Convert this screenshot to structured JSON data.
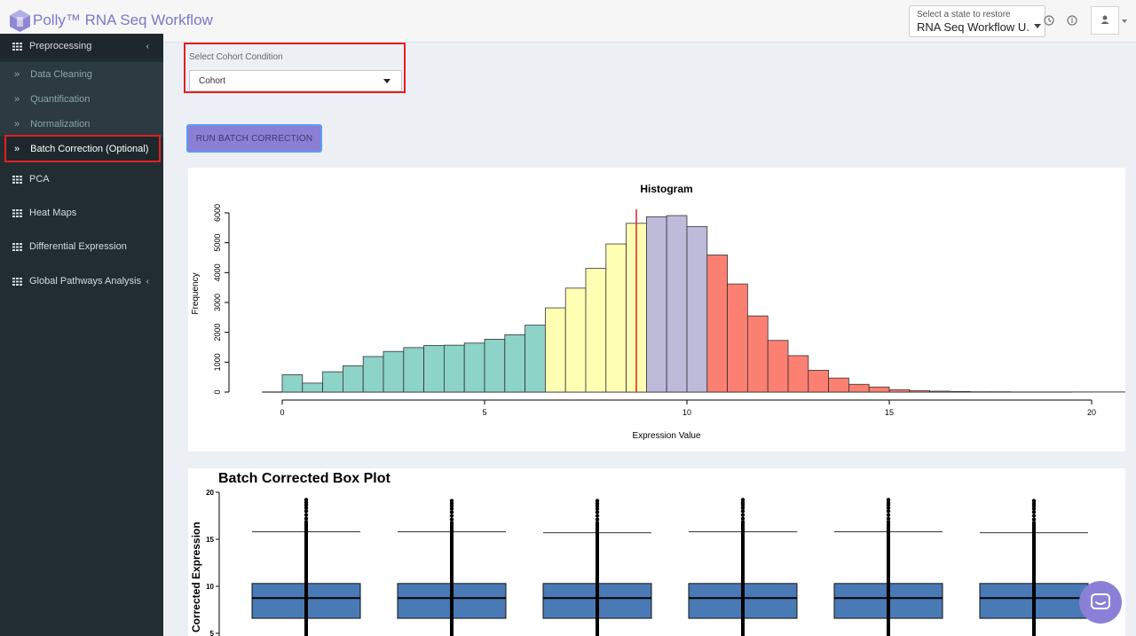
{
  "header": {
    "app_title": "Polly™ RNA Seq Workflow",
    "state_label": "Select a state to restore",
    "state_value": "RNA Seq Workflow U...",
    "icons": [
      "history-icon",
      "info-icon",
      "user-icon"
    ]
  },
  "sidebar": {
    "items": [
      {
        "label": "Preprocessing",
        "icon": "grid-icon",
        "chevron": "‹"
      },
      {
        "label": "Data Cleaning",
        "icon": "double-chevron-icon"
      },
      {
        "label": "Quantification",
        "icon": "double-chevron-icon"
      },
      {
        "label": "Normalization",
        "icon": "double-chevron-icon"
      },
      {
        "label": "Batch Correction (Optional)",
        "icon": "double-chevron-icon",
        "active": true
      },
      {
        "label": "PCA",
        "icon": "grid-icon"
      },
      {
        "label": "Heat Maps",
        "icon": "grid-icon"
      },
      {
        "label": "Differential Expression",
        "icon": "grid-icon"
      },
      {
        "label": "Global Pathways Analysis",
        "icon": "grid-icon",
        "chevron": "‹"
      }
    ]
  },
  "cohort": {
    "label": "Select Cohort Condition",
    "value": "Cohort"
  },
  "run_button": "RUN BATCH CORRECTION",
  "colors": {
    "accent": "#7d78c7",
    "button": "#8a7fd4",
    "highlight": "#e02020",
    "sidebar": "#222d32",
    "teal": "#8dd3c7",
    "yellow": "#ffffb3",
    "lavender": "#bebada",
    "salmon": "#fb8072",
    "box_fill": "#4a7ab5"
  },
  "chart_data": [
    {
      "type": "bar",
      "title": "Histogram",
      "xlabel": "Expression Value",
      "ylabel": "Frequency",
      "xlim": [
        0,
        20
      ],
      "ylim": [
        0,
        6000
      ],
      "x_ticks": [
        0,
        5,
        10,
        15,
        20
      ],
      "y_ticks": [
        0,
        1000,
        2000,
        3000,
        4000,
        5000,
        6000
      ],
      "bin_width": 0.5,
      "bin_start": 0,
      "values": [
        580,
        300,
        680,
        880,
        1190,
        1360,
        1490,
        1560,
        1570,
        1640,
        1770,
        1920,
        2240,
        2820,
        3480,
        4140,
        4960,
        5650,
        5870,
        5910,
        5540,
        4590,
        3620,
        2550,
        1730,
        1220,
        730,
        470,
        260,
        170,
        80,
        50,
        30,
        20,
        10,
        10,
        5,
        5,
        5,
        5,
        5,
        5
      ],
      "bin_colors": [
        "teal",
        "teal",
        "teal",
        "teal",
        "teal",
        "teal",
        "teal",
        "teal",
        "teal",
        "teal",
        "teal",
        "teal",
        "teal",
        "yellow",
        "yellow",
        "yellow",
        "yellow",
        "yellow",
        "lavender",
        "lavender",
        "lavender",
        "salmon",
        "salmon",
        "salmon",
        "salmon",
        "salmon",
        "salmon",
        "salmon",
        "salmon",
        "salmon",
        "salmon",
        "salmon",
        "salmon",
        "salmon",
        "salmon",
        "salmon",
        "salmon",
        "salmon",
        "salmon",
        "salmon",
        "salmon",
        "salmon"
      ],
      "baseline_range": [
        -0.5,
        19.5
      ],
      "vline": 8.75
    },
    {
      "type": "box",
      "title": "Batch Corrected Box Plot",
      "ylabel": "n Corrected Expression",
      "ylim": [
        5,
        20
      ],
      "y_ticks": [
        5,
        10,
        15,
        20
      ],
      "boxes": [
        {
          "q1": 6.6,
          "median": 8.75,
          "q3": 10.3,
          "upper_whisker": 15.8,
          "outlier_max": 19.2
        },
        {
          "q1": 6.6,
          "median": 8.75,
          "q3": 10.3,
          "upper_whisker": 15.8,
          "outlier_max": 19.1
        },
        {
          "q1": 6.6,
          "median": 8.75,
          "q3": 10.3,
          "upper_whisker": 15.7,
          "outlier_max": 19.1
        },
        {
          "q1": 6.6,
          "median": 8.75,
          "q3": 10.3,
          "upper_whisker": 15.8,
          "outlier_max": 19.2
        },
        {
          "q1": 6.6,
          "median": 8.75,
          "q3": 10.3,
          "upper_whisker": 15.8,
          "outlier_max": 19.2
        },
        {
          "q1": 6.6,
          "median": 8.75,
          "q3": 10.3,
          "upper_whisker": 15.7,
          "outlier_max": 19.1
        }
      ]
    }
  ]
}
